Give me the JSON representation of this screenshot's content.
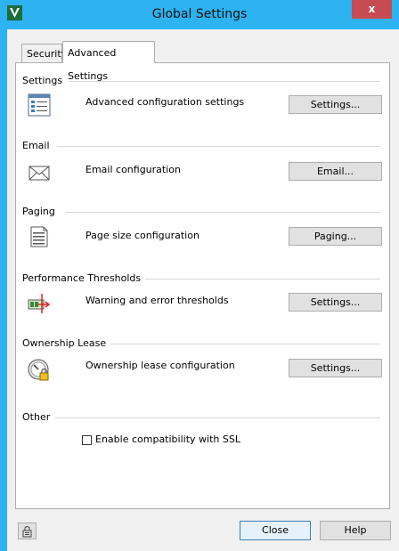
{
  "window": {
    "title": "Global Settings",
    "close_glyph": "x"
  },
  "tabs": [
    {
      "label": "Security",
      "active": false
    },
    {
      "label": "Advanced Settings",
      "active": true
    }
  ],
  "sections": {
    "settings": {
      "header": "Settings",
      "description": "Advanced configuration settings",
      "button": "Settings...",
      "icon": "settings-list-icon"
    },
    "email": {
      "header": "Email",
      "description": "Email configuration",
      "button": "Email...",
      "icon": "envelope-icon"
    },
    "paging": {
      "header": "Paging",
      "description": "Page size configuration",
      "button": "Paging...",
      "icon": "document-pages-icon"
    },
    "performance": {
      "header": "Performance Thresholds",
      "description": "Warning and error thresholds",
      "button": "Settings...",
      "icon": "threshold-icon"
    },
    "ownership": {
      "header": "Ownership Lease",
      "description": "Ownership lease configuration",
      "button": "Settings...",
      "icon": "gauge-lock-icon"
    },
    "other": {
      "header": "Other",
      "checkbox_label": "Enable compatibility with SSL",
      "checked": false
    }
  },
  "footer": {
    "close_label": "Close",
    "help_label": "Help",
    "lock_icon": "lock-icon"
  },
  "colors": {
    "titlebar": "#2cb3f0",
    "close_button": "#c74b52",
    "client_bg": "#f0f0f0",
    "panel_bg": "#ffffff"
  }
}
